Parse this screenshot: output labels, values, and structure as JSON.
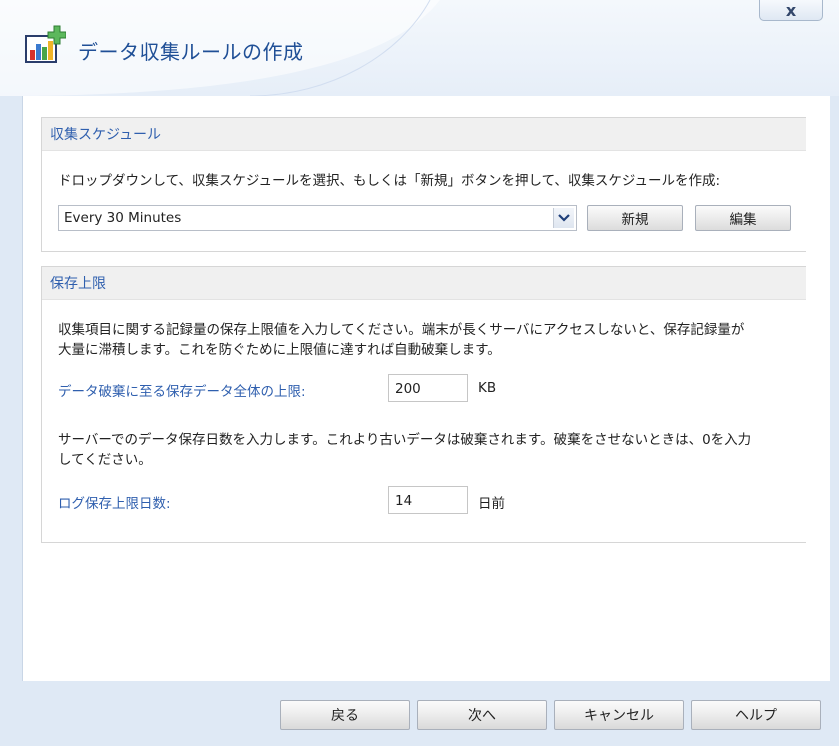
{
  "window": {
    "title": "データ収集ルールの作成",
    "close_label": "x"
  },
  "schedule": {
    "header": "収集スケジュール",
    "description": "ドロップダウンして、収集スケジュールを選択、もしくは「新規」ボタンを押して、収集スケジュールを作成:",
    "selected": "Every 30 Minutes",
    "new_label": "新規",
    "edit_label": "編集"
  },
  "limits": {
    "header": "保存上限",
    "desc1_line1": "収集項目に関する記録量の保存上限値を入力してください。端末が長くサーバにアクセスしないと、保存記録量が",
    "desc1_line2": "大量に滞積します。これを防ぐために上限値に達すれば自動破棄します。",
    "size_label": "データ破棄に至る保存データ全体の上限:",
    "size_value": "200",
    "size_unit": "KB",
    "desc2_line1": "サーバーでのデータ保存日数を入力します。これより古いデータは破棄されます。破棄をさせないときは、0を入力",
    "desc2_line2": "してください。",
    "days_label": "ログ保存上限日数:",
    "days_value": "14",
    "days_unit": "日前"
  },
  "footer": {
    "back_label": "戻る",
    "next_label": "次へ",
    "cancel_label": "キャンセル",
    "help_label": "ヘルプ"
  },
  "colors": {
    "accent": "#2f5fae",
    "title": "#1f4f96"
  },
  "icons": {
    "app": "chart-add-icon",
    "close": "close-icon",
    "dropdown": "chevron-down-icon"
  }
}
